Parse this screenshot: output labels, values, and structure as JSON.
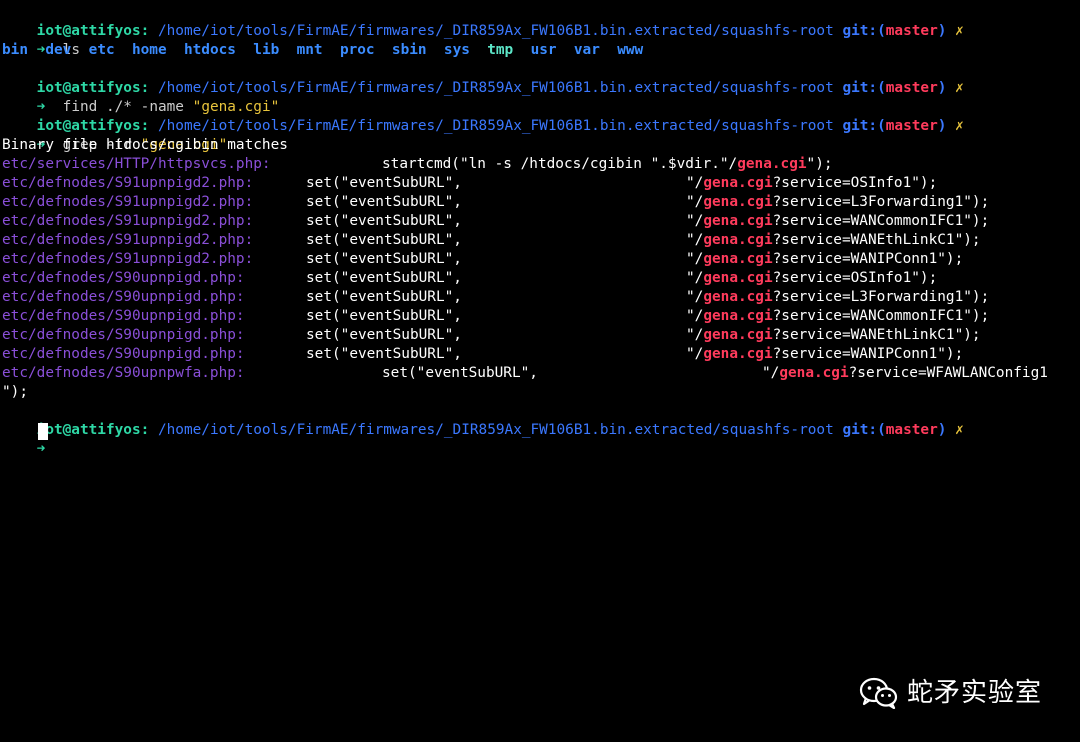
{
  "prompt": {
    "user": "iot@attifyos:",
    "path": "/home/iot/tools/FirmAE/firmwares/_DIR859Ax_FW106B1.bin.extracted/squashfs-root",
    "git_label": "git:(",
    "branch": "master",
    "git_close": ")",
    "dirty_mark": "✗",
    "arrow": "➜"
  },
  "commands": {
    "ls": "ls",
    "find_cmd": "find",
    "find_path": "./*",
    "find_flag": "-name",
    "find_arg": "\"gena.cgi\"",
    "grep_cmd": "grep",
    "grep_flag": "-ir",
    "grep_arg": "\"gena.cgi\""
  },
  "ls_output": {
    "bin": "bin",
    "dev": "dev",
    "etc": "etc",
    "home": "home",
    "htdocs": "htdocs",
    "lib": "lib",
    "mnt": "mnt",
    "proc": "proc",
    "sbin": "sbin",
    "sys": "sys",
    "tmp": "tmp",
    "usr": "usr",
    "var": "var",
    "www": "www"
  },
  "binary_match": "Binary file htdocs/cgibin matches",
  "grep_results": [
    {
      "file": "etc/services/HTTP/httpsvcs.php:",
      "code": "startcmd(\"ln -s /htdocs/cgibin \".$vdir.\"/",
      "match": "gena.cgi",
      "tail": "\");"
    },
    {
      "file": "etc/defnodes/S91upnpigd2.php:",
      "code": "set(\"eventSubURL\",",
      "pre": "\"/",
      "match": "gena.cgi",
      "tail": "?service=OSInfo1\");"
    },
    {
      "file": "etc/defnodes/S91upnpigd2.php:",
      "code": "set(\"eventSubURL\",",
      "pre": "\"/",
      "match": "gena.cgi",
      "tail": "?service=L3Forwarding1\");"
    },
    {
      "file": "etc/defnodes/S91upnpigd2.php:",
      "code": "set(\"eventSubURL\",",
      "pre": "\"/",
      "match": "gena.cgi",
      "tail": "?service=WANCommonIFC1\");"
    },
    {
      "file": "etc/defnodes/S91upnpigd2.php:",
      "code": "set(\"eventSubURL\",",
      "pre": "\"/",
      "match": "gena.cgi",
      "tail": "?service=WANEthLinkC1\");"
    },
    {
      "file": "etc/defnodes/S91upnpigd2.php:",
      "code": "set(\"eventSubURL\",",
      "pre": "\"/",
      "match": "gena.cgi",
      "tail": "?service=WANIPConn1\");"
    },
    {
      "file": "etc/defnodes/S90upnpigd.php:",
      "code": "set(\"eventSubURL\",",
      "pre": "\"/",
      "match": "gena.cgi",
      "tail": "?service=OSInfo1\");"
    },
    {
      "file": "etc/defnodes/S90upnpigd.php:",
      "code": "set(\"eventSubURL\",",
      "pre": "\"/",
      "match": "gena.cgi",
      "tail": "?service=L3Forwarding1\");"
    },
    {
      "file": "etc/defnodes/S90upnpigd.php:",
      "code": "set(\"eventSubURL\",",
      "pre": "\"/",
      "match": "gena.cgi",
      "tail": "?service=WANCommonIFC1\");"
    },
    {
      "file": "etc/defnodes/S90upnpigd.php:",
      "code": "set(\"eventSubURL\",",
      "pre": "\"/",
      "match": "gena.cgi",
      "tail": "?service=WANEthLinkC1\");"
    },
    {
      "file": "etc/defnodes/S90upnpigd.php:",
      "code": "set(\"eventSubURL\",",
      "pre": "\"/",
      "match": "gena.cgi",
      "tail": "?service=WANIPConn1\");"
    },
    {
      "file": "etc/defnodes/S90upnpwfa.php:",
      "code": "set(\"eventSubURL\",",
      "pre": "\"/",
      "match": "gena.cgi",
      "tail": "?service=WFAWLANConfig1"
    }
  ],
  "wrap_tail": "\");",
  "watermark": {
    "text": "蛇矛实验室",
    "icon": "wechat-icon"
  },
  "colors": {
    "background": "#000000",
    "user": "#2ed8a6",
    "path": "#3b78ff",
    "branch": "#ff3b5c",
    "match": "#ff3b5c",
    "file": "#8a4fd8",
    "string": "#e8c43c"
  }
}
